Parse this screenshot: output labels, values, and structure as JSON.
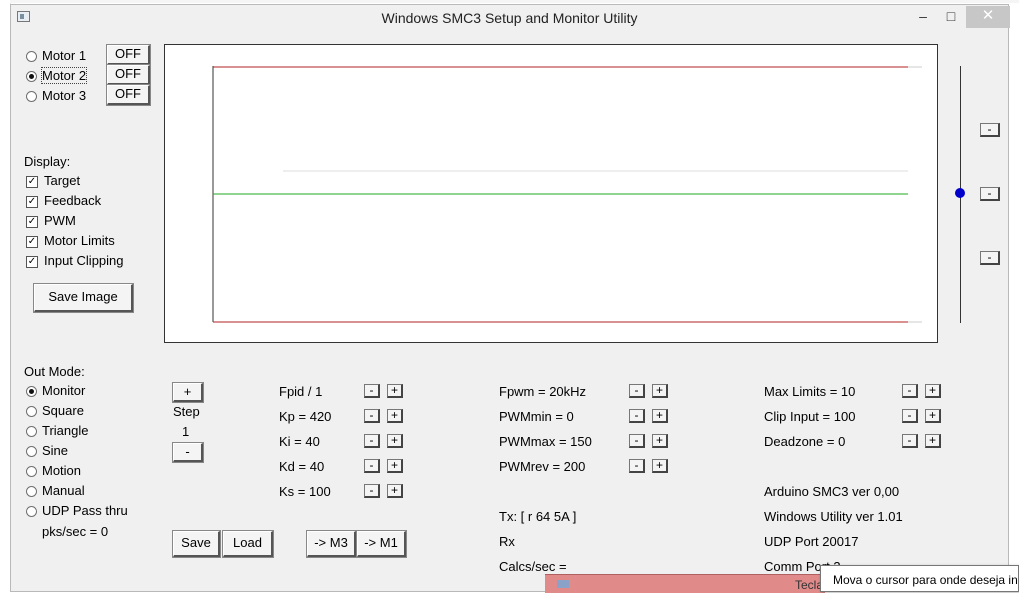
{
  "window": {
    "title": "Windows SMC3 Setup and Monitor Utility",
    "minimize_glyph": "–",
    "maximize_glyph": "□",
    "close_glyph": "✕"
  },
  "motors": [
    {
      "label": "Motor 1",
      "selected": false,
      "state": "OFF"
    },
    {
      "label": "Motor 2",
      "selected": true,
      "state": "OFF"
    },
    {
      "label": "Motor 3",
      "selected": false,
      "state": "OFF"
    }
  ],
  "display": {
    "heading": "Display:",
    "options": [
      {
        "label": "Target",
        "checked": true
      },
      {
        "label": "Feedback",
        "checked": true
      },
      {
        "label": "PWM",
        "checked": true
      },
      {
        "label": "Motor Limits",
        "checked": true
      },
      {
        "label": "Input Clipping",
        "checked": true
      }
    ],
    "save_image": "Save Image"
  },
  "out_mode": {
    "heading": "Out Mode:",
    "options": [
      {
        "label": "Monitor",
        "selected": true
      },
      {
        "label": "Square",
        "selected": false
      },
      {
        "label": "Triangle",
        "selected": false
      },
      {
        "label": "Sine",
        "selected": false
      },
      {
        "label": "Motion",
        "selected": false
      },
      {
        "label": "Manual",
        "selected": false
      },
      {
        "label": "UDP Pass thru",
        "selected": false
      }
    ],
    "pks": "pks/sec = 0"
  },
  "step": {
    "plus": "+",
    "label": "Step",
    "value": "1",
    "minus": "-"
  },
  "pid": [
    "Fpid / 1",
    "Kp = 420",
    "Ki = 40",
    "Kd = 40",
    "Ks = 100"
  ],
  "pwm": [
    "Fpwm = 20kHz",
    "PWMmin = 0",
    "PWMmax = 150",
    "PWMrev = 200"
  ],
  "limits": [
    "Max Limits = 10",
    "Clip Input = 100",
    "Deadzone = 0"
  ],
  "actions": {
    "save": "Save",
    "load": "Load",
    "to_m3": "-> M3",
    "to_m1": "-> M1"
  },
  "comm": {
    "tx": "Tx: [ r 64 5A ]",
    "rx": "Rx",
    "calcs": "Calcs/sec ="
  },
  "info": {
    "arduino": "Arduino SMC3 ver 0,00",
    "windows": "Windows Utility ver 1.01",
    "udp": "UDP Port 20017",
    "comm_port": "Comm Port 3"
  },
  "spin": {
    "minus": "-",
    "plus": "+"
  },
  "side_buttons": [
    "-",
    "-",
    "-"
  ],
  "slider_position_fraction": 0.5,
  "colors": {
    "limit_line": "#b22222",
    "feedback_line": "#22aa22",
    "slider_knob": "#0000cc",
    "tooltip_bg": "#ffffff",
    "taskbar_strip": "#e18a8a"
  },
  "tooltip": "Mova o cursor para onde deseja inserir",
  "taskbar_label": "Tecla"
}
